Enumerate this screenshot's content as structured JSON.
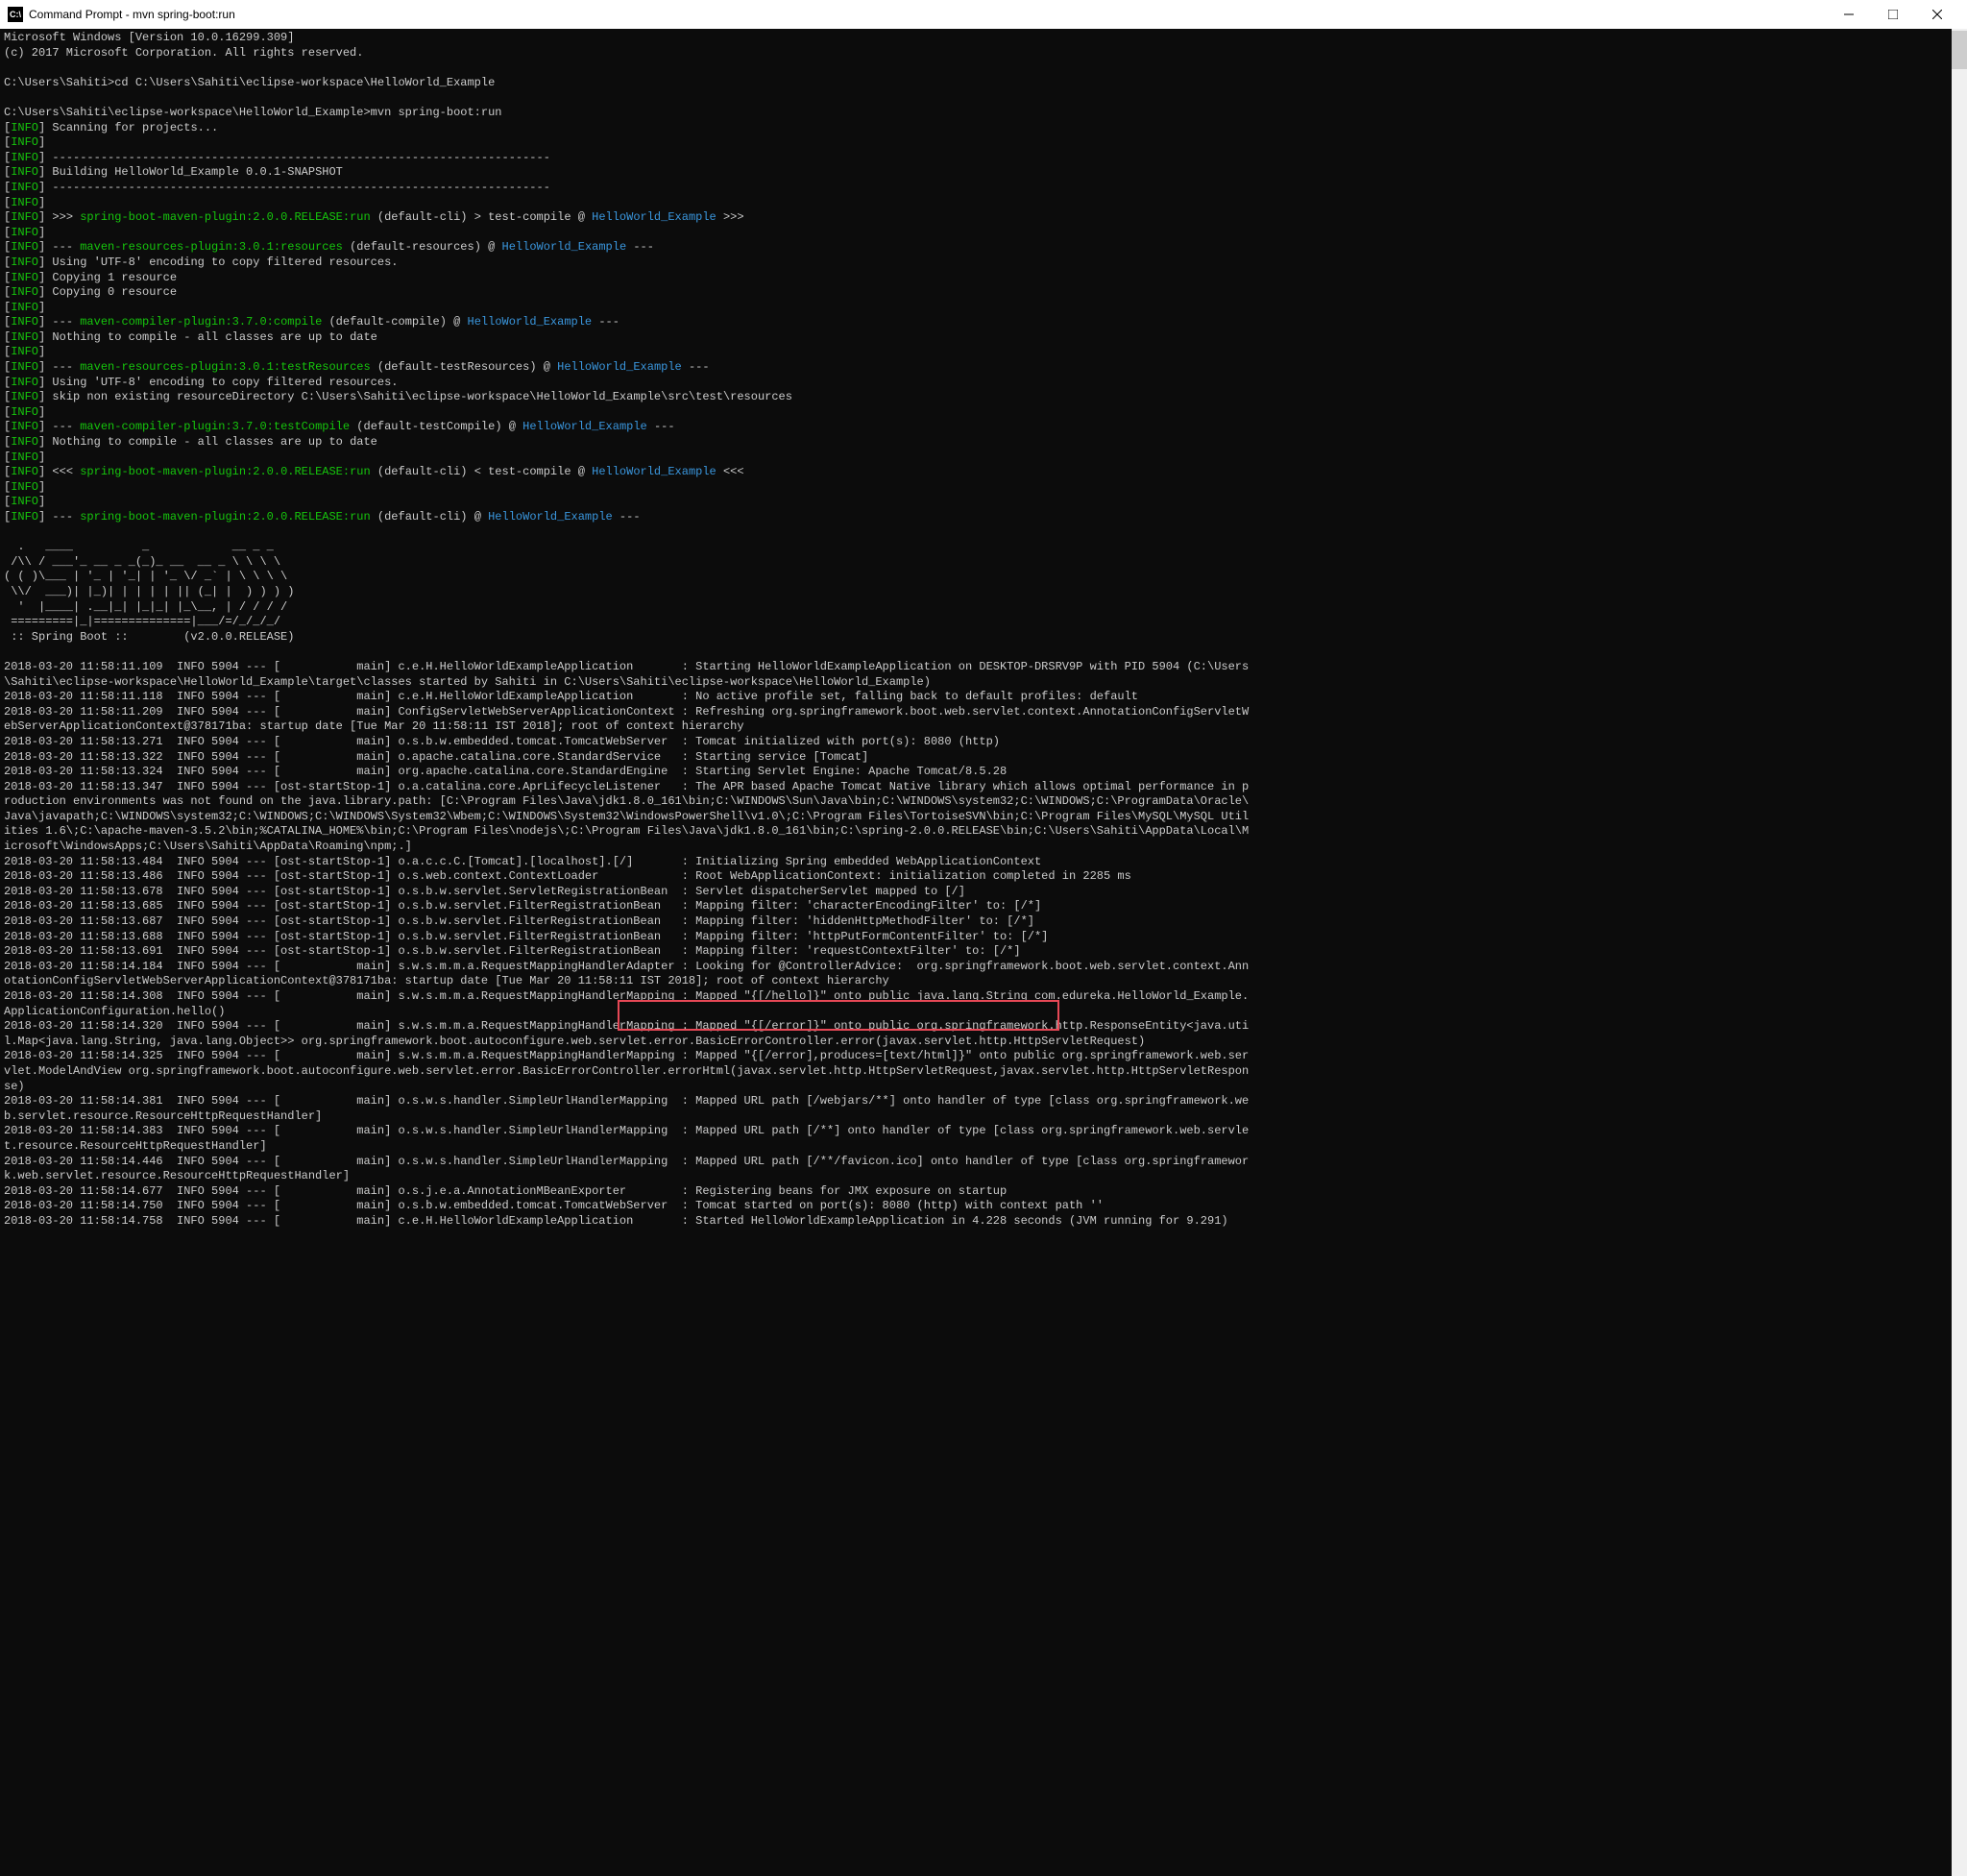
{
  "titlebar": {
    "title": "Command Prompt - mvn  spring-boot:run"
  },
  "header": [
    "Microsoft Windows [Version 10.0.16299.309]",
    "(c) 2017 Microsoft Corporation. All rights reserved.",
    "",
    "C:\\Users\\Sahiti>cd C:\\Users\\Sahiti\\eclipse-workspace\\HelloWorld_Example",
    "",
    "C:\\Users\\Sahiti\\eclipse-workspace\\HelloWorld_Example>mvn spring-boot:run"
  ],
  "info_lines": [
    {
      "t": "plain",
      "txt": "Scanning for projects..."
    },
    {
      "t": "blank"
    },
    {
      "t": "dash"
    },
    {
      "t": "plain",
      "txt": "Building HelloWorld_Example 0.0.1-SNAPSHOT"
    },
    {
      "t": "dash"
    },
    {
      "t": "blank"
    },
    {
      "t": "plugin",
      "pre": ">>> ",
      "plugin": "spring-boot-maven-plugin:2.0.0.RELEASE:run",
      "mid": " (default-cli) > test-compile @ ",
      "proj": "HelloWorld_Example",
      "post": " >>>"
    },
    {
      "t": "blank"
    },
    {
      "t": "plugin",
      "pre": "--- ",
      "plugin": "maven-resources-plugin:3.0.1:resources",
      "mid": " (default-resources) @ ",
      "proj": "HelloWorld_Example",
      "post": " ---"
    },
    {
      "t": "plain",
      "txt": "Using 'UTF-8' encoding to copy filtered resources."
    },
    {
      "t": "plain",
      "txt": "Copying 1 resource"
    },
    {
      "t": "plain",
      "txt": "Copying 0 resource"
    },
    {
      "t": "blank"
    },
    {
      "t": "plugin",
      "pre": "--- ",
      "plugin": "maven-compiler-plugin:3.7.0:compile",
      "mid": " (default-compile) @ ",
      "proj": "HelloWorld_Example",
      "post": " ---"
    },
    {
      "t": "plain",
      "txt": "Nothing to compile - all classes are up to date"
    },
    {
      "t": "blank"
    },
    {
      "t": "plugin",
      "pre": "--- ",
      "plugin": "maven-resources-plugin:3.0.1:testResources",
      "mid": " (default-testResources) @ ",
      "proj": "HelloWorld_Example",
      "post": " ---"
    },
    {
      "t": "plain",
      "txt": "Using 'UTF-8' encoding to copy filtered resources."
    },
    {
      "t": "plain",
      "txt": "skip non existing resourceDirectory C:\\Users\\Sahiti\\eclipse-workspace\\HelloWorld_Example\\src\\test\\resources"
    },
    {
      "t": "blank"
    },
    {
      "t": "plugin",
      "pre": "--- ",
      "plugin": "maven-compiler-plugin:3.7.0:testCompile",
      "mid": " (default-testCompile) @ ",
      "proj": "HelloWorld_Example",
      "post": " ---"
    },
    {
      "t": "plain",
      "txt": "Nothing to compile - all classes are up to date"
    },
    {
      "t": "blank"
    },
    {
      "t": "plugin",
      "pre": "<<< ",
      "plugin": "spring-boot-maven-plugin:2.0.0.RELEASE:run",
      "mid": " (default-cli) < test-compile @ ",
      "proj": "HelloWorld_Example",
      "post": " <<<"
    },
    {
      "t": "blank"
    },
    {
      "t": "blank"
    },
    {
      "t": "plugin",
      "pre": "--- ",
      "plugin": "spring-boot-maven-plugin:2.0.0.RELEASE:run",
      "mid": " (default-cli) @ ",
      "proj": "HelloWorld_Example",
      "post": " ---"
    }
  ],
  "banner": [
    "",
    "  .   ____          _            __ _ _",
    " /\\\\ / ___'_ __ _ _(_)_ __  __ _ \\ \\ \\ \\",
    "( ( )\\___ | '_ | '_| | '_ \\/ _` | \\ \\ \\ \\",
    " \\\\/  ___)| |_)| | | | | || (_| |  ) ) ) )",
    "  '  |____| .__|_| |_|_| |_\\__, | / / / /",
    " =========|_|==============|___/=/_/_/_/",
    " :: Spring Boot ::        (v2.0.0.RELEASE)",
    ""
  ],
  "logs": [
    "2018-03-20 11:58:11.109  INFO 5904 --- [           main] c.e.H.HelloWorldExampleApplication       : Starting HelloWorldExampleApplication on DESKTOP-DRSRV9P with PID 5904 (C:\\Users\\Sahiti\\eclipse-workspace\\HelloWorld_Example\\target\\classes started by Sahiti in C:\\Users\\Sahiti\\eclipse-workspace\\HelloWorld_Example)",
    "2018-03-20 11:58:11.118  INFO 5904 --- [           main] c.e.H.HelloWorldExampleApplication       : No active profile set, falling back to default profiles: default",
    "2018-03-20 11:58:11.209  INFO 5904 --- [           main] ConfigServletWebServerApplicationContext : Refreshing org.springframework.boot.web.servlet.context.AnnotationConfigServletWebServerApplicationContext@378171ba: startup date [Tue Mar 20 11:58:11 IST 2018]; root of context hierarchy",
    "2018-03-20 11:58:13.271  INFO 5904 --- [           main] o.s.b.w.embedded.tomcat.TomcatWebServer  : Tomcat initialized with port(s): 8080 (http)",
    "2018-03-20 11:58:13.322  INFO 5904 --- [           main] o.apache.catalina.core.StandardService   : Starting service [Tomcat]",
    "2018-03-20 11:58:13.324  INFO 5904 --- [           main] org.apache.catalina.core.StandardEngine  : Starting Servlet Engine: Apache Tomcat/8.5.28",
    "2018-03-20 11:58:13.347  INFO 5904 --- [ost-startStop-1] o.a.catalina.core.AprLifecycleListener   : The APR based Apache Tomcat Native library which allows optimal performance in production environments was not found on the java.library.path: [C:\\Program Files\\Java\\jdk1.8.0_161\\bin;C:\\WINDOWS\\Sun\\Java\\bin;C:\\WINDOWS\\system32;C:\\WINDOWS;C:\\ProgramData\\Oracle\\Java\\javapath;C:\\WINDOWS\\system32;C:\\WINDOWS;C:\\WINDOWS\\System32\\Wbem;C:\\WINDOWS\\System32\\WindowsPowerShell\\v1.0\\;C:\\Program Files\\TortoiseSVN\\bin;C:\\Program Files\\MySQL\\MySQL Utilities 1.6\\;C:\\apache-maven-3.5.2\\bin;%CATALINA_HOME%\\bin;C:\\Program Files\\nodejs\\;C:\\Program Files\\Java\\jdk1.8.0_161\\bin;C:\\spring-2.0.0.RELEASE\\bin;C:\\Users\\Sahiti\\AppData\\Local\\Microsoft\\WindowsApps;C:\\Users\\Sahiti\\AppData\\Roaming\\npm;.]",
    "2018-03-20 11:58:13.484  INFO 5904 --- [ost-startStop-1] o.a.c.c.C.[Tomcat].[localhost].[/]       : Initializing Spring embedded WebApplicationContext",
    "2018-03-20 11:58:13.486  INFO 5904 --- [ost-startStop-1] o.s.web.context.ContextLoader            : Root WebApplicationContext: initialization completed in 2285 ms",
    "2018-03-20 11:58:13.678  INFO 5904 --- [ost-startStop-1] o.s.b.w.servlet.ServletRegistrationBean  : Servlet dispatcherServlet mapped to [/]",
    "2018-03-20 11:58:13.685  INFO 5904 --- [ost-startStop-1] o.s.b.w.servlet.FilterRegistrationBean   : Mapping filter: 'characterEncodingFilter' to: [/*]",
    "2018-03-20 11:58:13.687  INFO 5904 --- [ost-startStop-1] o.s.b.w.servlet.FilterRegistrationBean   : Mapping filter: 'hiddenHttpMethodFilter' to: [/*]",
    "2018-03-20 11:58:13.688  INFO 5904 --- [ost-startStop-1] o.s.b.w.servlet.FilterRegistrationBean   : Mapping filter: 'httpPutFormContentFilter' to: [/*]",
    "2018-03-20 11:58:13.691  INFO 5904 --- [ost-startStop-1] o.s.b.w.servlet.FilterRegistrationBean   : Mapping filter: 'requestContextFilter' to: [/*]",
    "2018-03-20 11:58:14.184  INFO 5904 --- [           main] s.w.s.m.m.a.RequestMappingHandlerAdapter : Looking for @ControllerAdvice:  org.springframework.boot.web.servlet.context.AnnotationConfigServletWebServerApplicationContext@378171ba: startup date [Tue Mar 20 11:58:11 IST 2018]; root of context hierarchy",
    "2018-03-20 11:58:14.308  INFO 5904 --- [           main] s.w.s.m.m.a.RequestMappingHandlerMapping : Mapped \"{[/hello]}\" onto public java.lang.String com.edureka.HelloWorld_Example.ApplicationConfiguration.hello()",
    "2018-03-20 11:58:14.320  INFO 5904 --- [           main] s.w.s.m.m.a.RequestMappingHandlerMapping : Mapped \"{[/error]}\" onto public org.springframework.http.ResponseEntity<java.util.Map<java.lang.String, java.lang.Object>> org.springframework.boot.autoconfigure.web.servlet.error.BasicErrorController.error(javax.servlet.http.HttpServletRequest)",
    "2018-03-20 11:58:14.325  INFO 5904 --- [           main] s.w.s.m.m.a.RequestMappingHandlerMapping : Mapped \"{[/error],produces=[text/html]}\" onto public org.springframework.web.servlet.ModelAndView org.springframework.boot.autoconfigure.web.servlet.error.BasicErrorController.errorHtml(javax.servlet.http.HttpServletRequest,javax.servlet.http.HttpServletResponse)",
    "2018-03-20 11:58:14.381  INFO 5904 --- [           main] o.s.w.s.handler.SimpleUrlHandlerMapping  : Mapped URL path [/webjars/**] onto handler of type [class org.springframework.web.servlet.resource.ResourceHttpRequestHandler]",
    "2018-03-20 11:58:14.383  INFO 5904 --- [           main] o.s.w.s.handler.SimpleUrlHandlerMapping  : Mapped URL path [/**] onto handler of type [class org.springframework.web.servlet.resource.ResourceHttpRequestHandler]",
    "2018-03-20 11:58:14.446  INFO 5904 --- [           main] o.s.w.s.handler.SimpleUrlHandlerMapping  : Mapped URL path [/**/favicon.ico] onto handler of type [class org.springframework.web.servlet.resource.ResourceHttpRequestHandler]",
    "2018-03-20 11:58:14.677  INFO 5904 --- [           main] o.s.j.e.a.AnnotationMBeanExporter        : Registering beans for JMX exposure on startup",
    "2018-03-20 11:58:14.750  INFO 5904 --- [           main] o.s.b.w.embedded.tomcat.TomcatWebServer  : Tomcat started on port(s): 8080 (http) with context path ''",
    "2018-03-20 11:58:14.758  INFO 5904 --- [           main] c.e.H.HelloWorldExampleApplication       : Started HelloWorldExampleApplication in 4.228 seconds (JVM running for 9.291)"
  ],
  "info_tag": "INFO",
  "dash": "------------------------------------------------------------------------"
}
